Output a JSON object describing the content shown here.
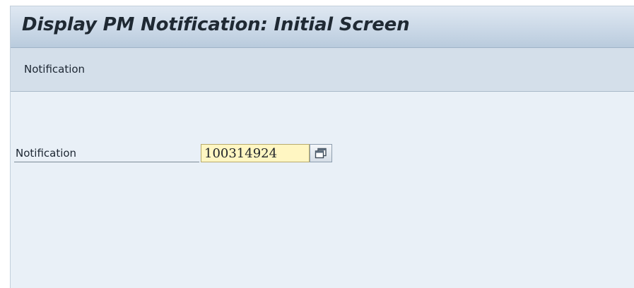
{
  "window": {
    "title": "Display PM Notification: Initial Screen"
  },
  "menu": {
    "items": [
      {
        "label": "Notification"
      }
    ]
  },
  "form": {
    "notification_label": "Notification",
    "notification_value": "100314924"
  },
  "icons": {
    "value_help": "value-help-icon"
  },
  "colors": {
    "input_background": "#fff6c2",
    "window_background": "#e9f0f7"
  }
}
